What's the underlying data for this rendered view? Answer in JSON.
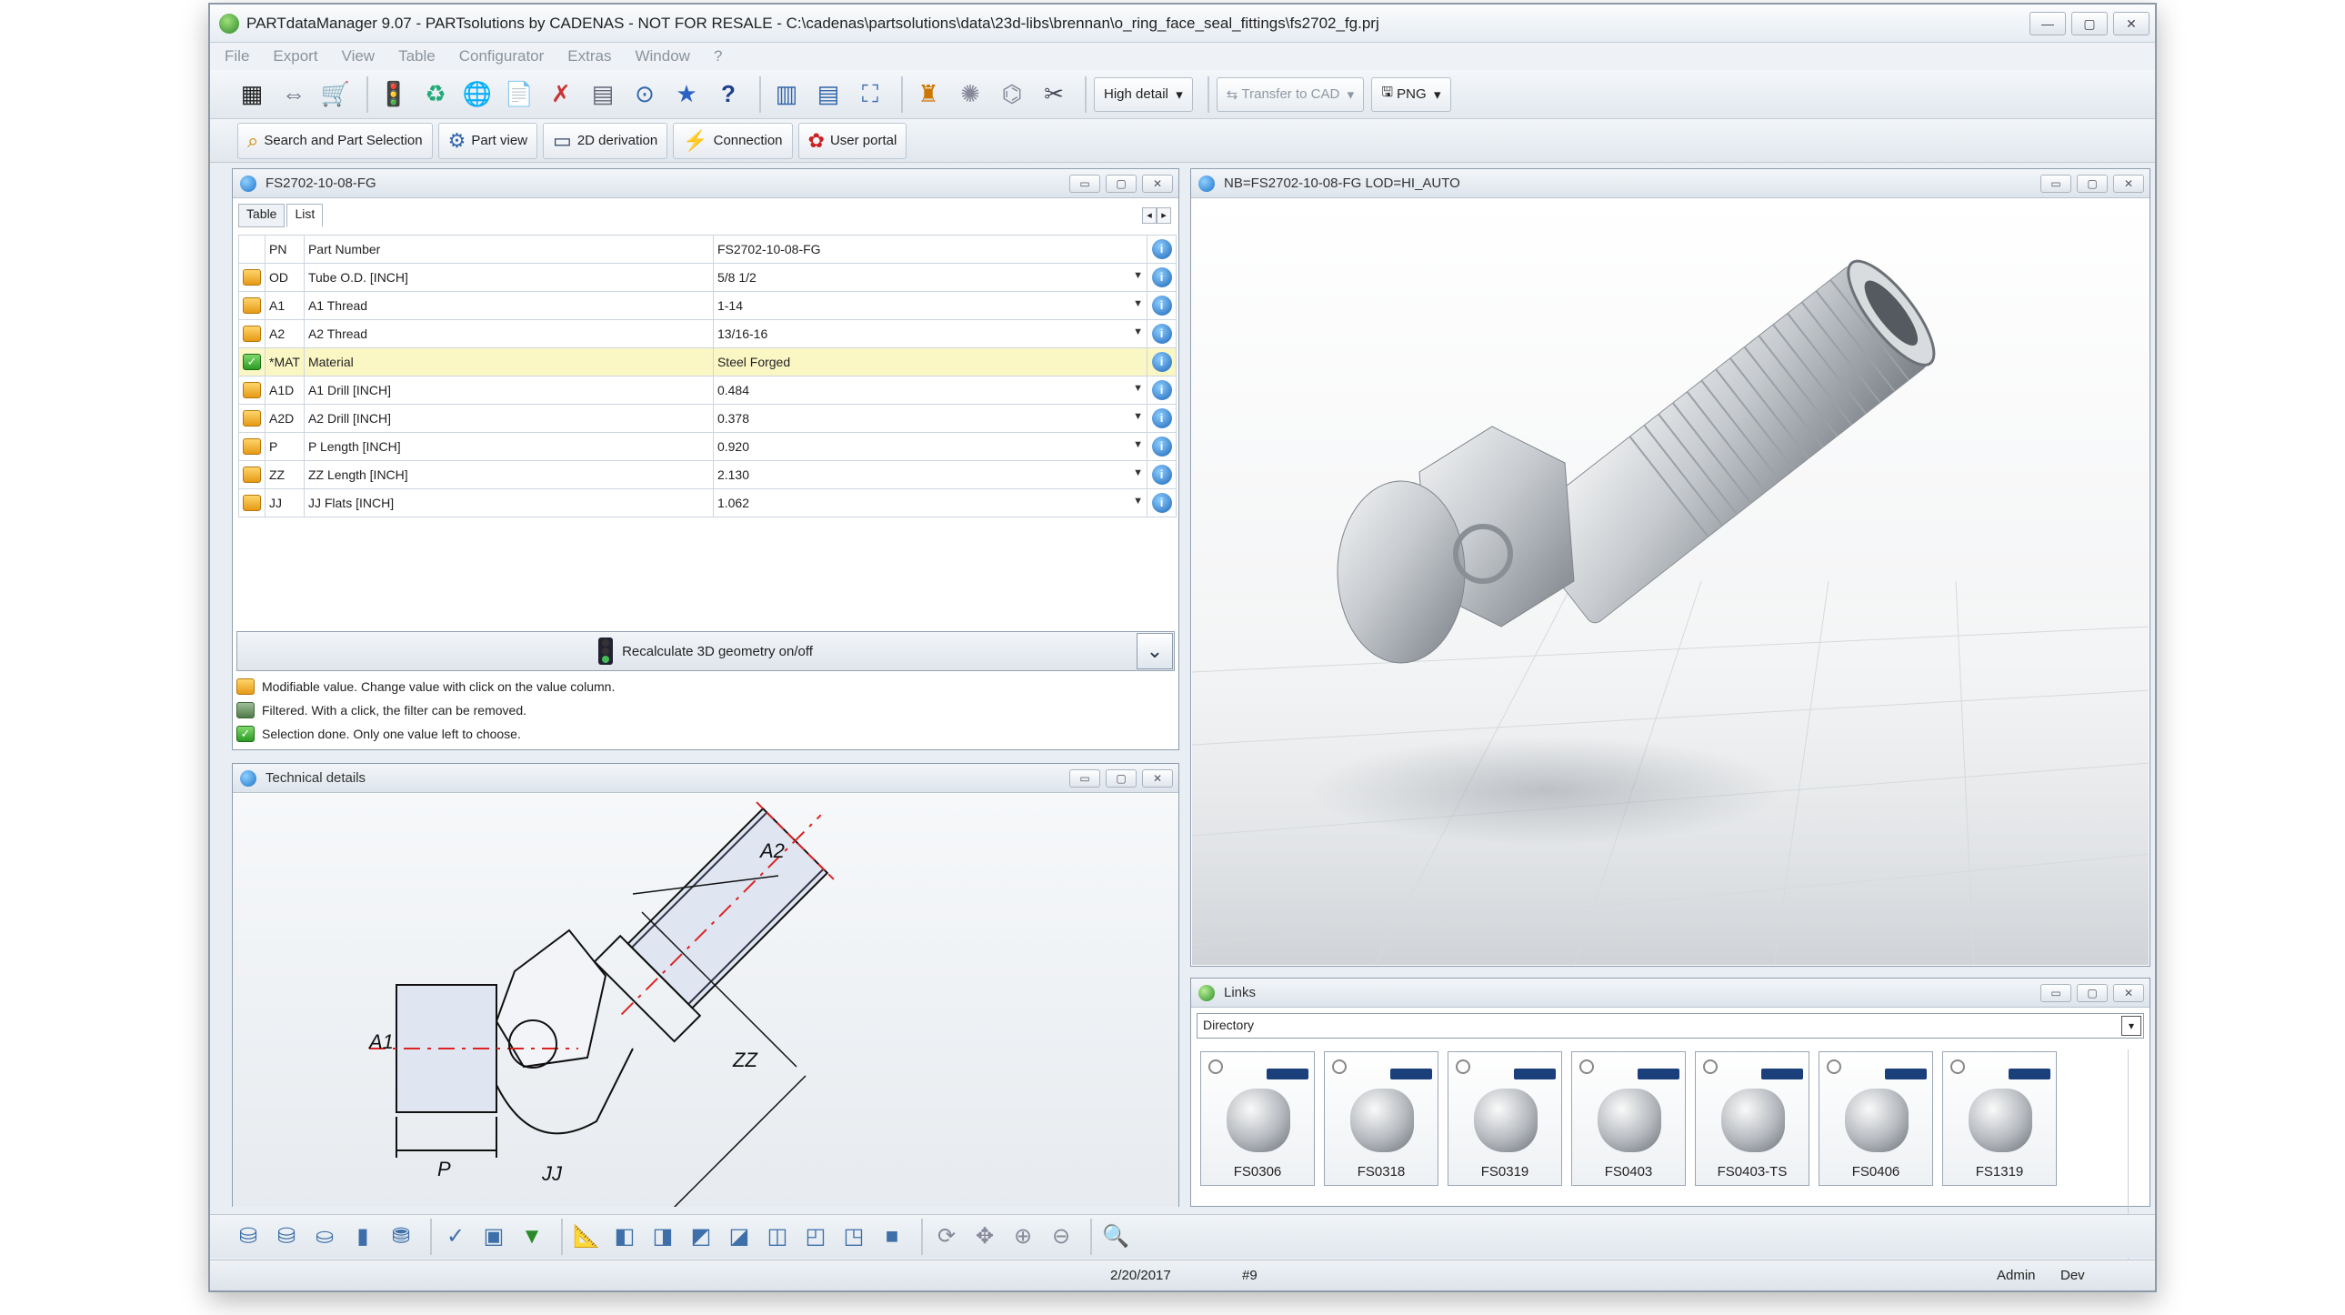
{
  "window": {
    "title": "PARTdataManager 9.07 - PARTsolutions by CADENAS - NOT FOR RESALE - C:\\cadenas\\partsolutions\\data\\23d-libs\\brennan\\o_ring_face_seal_fittings\\fs2702_fg.prj"
  },
  "menu": [
    "File",
    "Export",
    "View",
    "Table",
    "Configurator",
    "Extras",
    "Window",
    "?"
  ],
  "toolbar": {
    "detail_combo": "High detail",
    "transfer_label": "Transfer to CAD",
    "format_combo": "PNG"
  },
  "toolbar2": [
    "Search and Part Selection",
    "Part view",
    "2D derivation",
    "Connection",
    "User portal"
  ],
  "table_panel": {
    "title": "FS2702-10-08-FG",
    "tabs": [
      "Table",
      "List"
    ],
    "rows": [
      {
        "code": "PN",
        "name": "Part Number",
        "value": "FS2702-10-08-FG",
        "status": "none",
        "dropdown": false
      },
      {
        "code": "OD",
        "name": "Tube O.D. [INCH]",
        "value": "5/8 1/2",
        "status": "mod",
        "dropdown": true
      },
      {
        "code": "A1",
        "name": "A1 Thread",
        "value": "1-14",
        "status": "mod",
        "dropdown": true
      },
      {
        "code": "A2",
        "name": "A2 Thread",
        "value": "13/16-16",
        "status": "mod",
        "dropdown": true
      },
      {
        "code": "*MAT",
        "name": "Material",
        "value": "Steel Forged",
        "status": "done",
        "dropdown": false
      },
      {
        "code": "A1D",
        "name": "A1 Drill [INCH]",
        "value": "0.484",
        "status": "mod",
        "dropdown": true
      },
      {
        "code": "A2D",
        "name": "A2 Drill [INCH]",
        "value": "0.378",
        "status": "mod",
        "dropdown": true
      },
      {
        "code": "P",
        "name": "P Length [INCH]",
        "value": "0.920",
        "status": "mod",
        "dropdown": true
      },
      {
        "code": "ZZ",
        "name": "ZZ Length [INCH]",
        "value": "2.130",
        "status": "mod",
        "dropdown": true
      },
      {
        "code": "JJ",
        "name": "JJ Flats [INCH]",
        "value": "1.062",
        "status": "mod",
        "dropdown": true
      }
    ],
    "recalc_label": "Recalculate 3D geometry on/off",
    "legend": [
      "Modifiable value. Change value with click on the value column.",
      "Filtered. With a click, the filter can be removed.",
      "Selection done. Only one value left to choose."
    ]
  },
  "view3d_panel": {
    "title": "NB=FS2702-10-08-FG LOD=HI_AUTO"
  },
  "tech_panel": {
    "title": "Technical details",
    "dims": [
      "A2",
      "ZZ",
      "A1",
      "P",
      "JJ"
    ]
  },
  "links_panel": {
    "title": "Links",
    "directory": "Directory",
    "items": [
      "FS0306",
      "FS0318",
      "FS0319",
      "FS0403",
      "FS0403-TS",
      "FS0406",
      "FS1319"
    ]
  },
  "status": {
    "date": "2/20/2017",
    "count": "#9",
    "user": "Admin",
    "mode": "Dev"
  },
  "colors": {
    "accent": "#1e73c8",
    "modifiable": "#f0a830",
    "done": "#2c9b24",
    "highlight": "#fbf7c5"
  }
}
